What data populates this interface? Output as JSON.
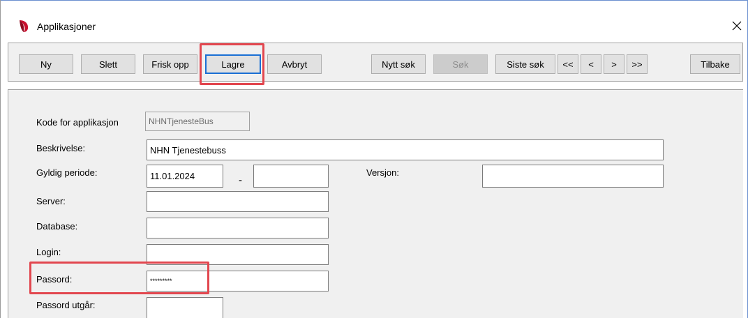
{
  "window": {
    "title": "Applikasjoner",
    "close_glyph": "✕"
  },
  "toolbar": {
    "ny": "Ny",
    "slett": "Slett",
    "frisk_opp": "Frisk opp",
    "lagre": "Lagre",
    "avbryt": "Avbryt",
    "nytt_sok": "Nytt søk",
    "sok": "Søk",
    "siste_sok": "Siste søk",
    "first": "<<",
    "prev": "<",
    "next": ">",
    "last": ">>",
    "tilbake": "Tilbake"
  },
  "form": {
    "kode_label": "Kode for applikasjon",
    "kode_value": "NHNTjenesteBus",
    "beskrivelse_label": "Beskrivelse:",
    "beskrivelse_value": "NHN Tjenestebuss",
    "gyldig_label": "Gyldig periode:",
    "gyldig_from": "11.01.2024",
    "gyldig_sep": "-",
    "gyldig_to": "",
    "versjon_label": "Versjon:",
    "versjon_value": "",
    "server_label": "Server:",
    "server_value": "",
    "database_label": "Database:",
    "database_value": "",
    "login_label": "Login:",
    "login_value": "",
    "passord_label": "Passord:",
    "passord_value": "*********",
    "passord_utgar_label": "Passord utgår:",
    "passord_utgar_value": ""
  },
  "colors": {
    "highlight": "#e2474f",
    "focus": "#1a6fd4",
    "logo": "#c8102e"
  },
  "icons": {
    "app": "app-logo-icon",
    "close": "close-icon"
  }
}
